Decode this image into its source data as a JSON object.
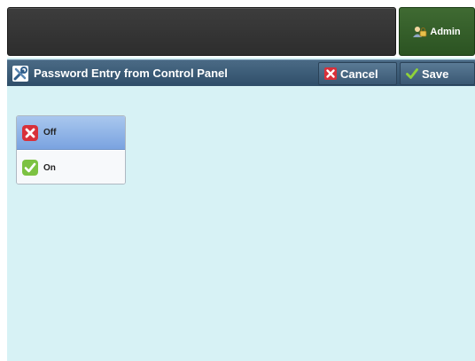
{
  "header": {
    "user_label": "Admin"
  },
  "titlebar": {
    "title": "Password Entry from Control Panel",
    "cancel_label": "Cancel",
    "save_label": "Save"
  },
  "options": [
    {
      "label": "Off",
      "selected": true,
      "icon": "red-x-icon"
    },
    {
      "label": "On",
      "selected": false,
      "icon": "green-check-icon"
    }
  ],
  "colors": {
    "accent_title": "#3a5873",
    "background": "#d7f2f5",
    "admin_tab": "#3f6a32",
    "selected_option": "#7aa3e0"
  }
}
